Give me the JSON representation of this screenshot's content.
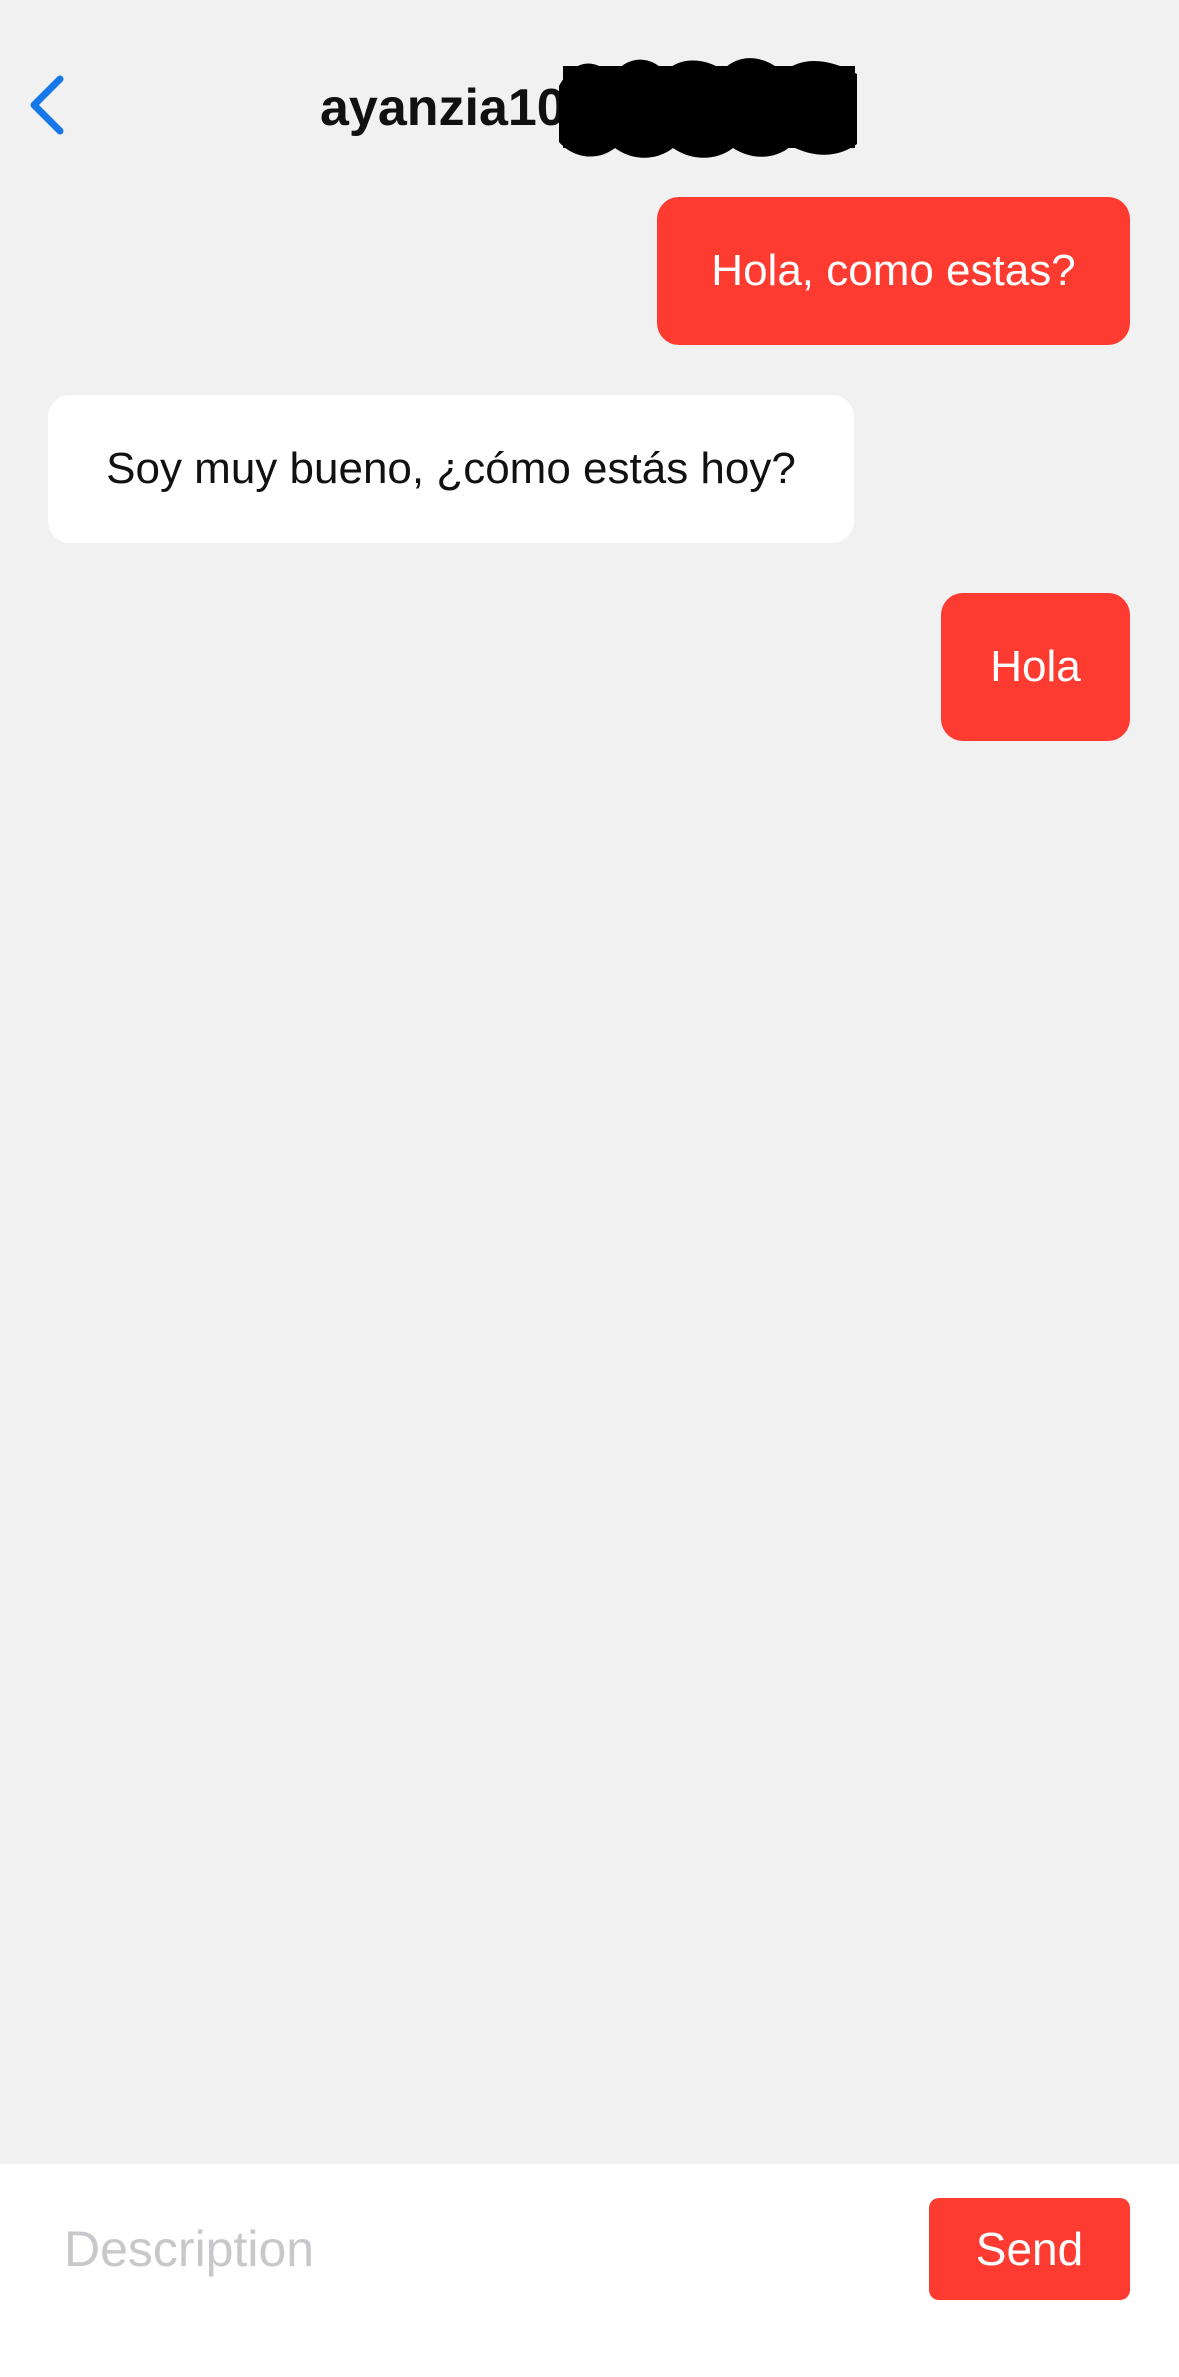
{
  "header": {
    "title": "ayanzia10",
    "back_icon": "chevron-left-icon",
    "accent_color": "#1677e8"
  },
  "messages": [
    {
      "direction": "sent",
      "text": "Hola, como estas?"
    },
    {
      "direction": "received",
      "text": "Soy muy bueno, ¿cómo estás hoy?"
    },
    {
      "direction": "sent",
      "text": "Hola"
    }
  ],
  "composer": {
    "placeholder": "Description",
    "value": "",
    "send_label": "Send"
  },
  "colors": {
    "background": "#f1f1f2",
    "sent_bubble": "#fe3b30",
    "received_bubble": "#ffffff",
    "send_button": "#fe3b30",
    "placeholder": "#c7c7cc"
  }
}
